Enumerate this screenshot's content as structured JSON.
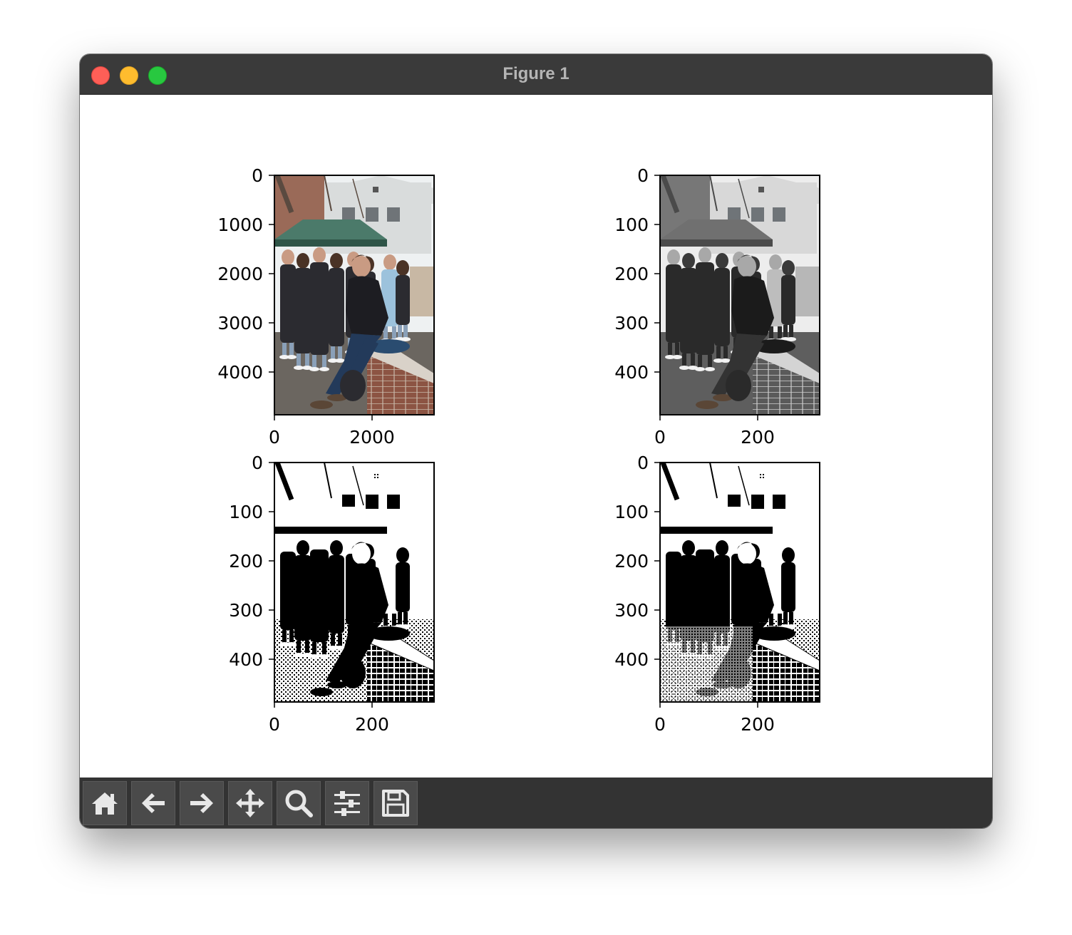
{
  "window": {
    "title": "Figure 1"
  },
  "toolbar": {
    "buttons": [
      {
        "name": "home-button",
        "icon": "home-icon"
      },
      {
        "name": "back-button",
        "icon": "arrow-left-icon"
      },
      {
        "name": "forward-button",
        "icon": "arrow-right-icon"
      },
      {
        "name": "pan-button",
        "icon": "move-icon"
      },
      {
        "name": "zoom-button",
        "icon": "search-icon"
      },
      {
        "name": "configure-subplots-button",
        "icon": "sliders-icon"
      },
      {
        "name": "save-button",
        "icon": "save-icon"
      }
    ]
  },
  "figure": {
    "subplots": [
      {
        "name": "original-color-image",
        "style": "color",
        "yticks": [
          "0",
          "1000",
          "2000",
          "3000",
          "4000"
        ],
        "xticks": [
          "0",
          "2000"
        ]
      },
      {
        "name": "grayscale-image",
        "style": "gray",
        "yticks": [
          "0",
          "100",
          "200",
          "300",
          "400"
        ],
        "xticks": [
          "0",
          "200"
        ]
      },
      {
        "name": "threshold-image",
        "style": "binary",
        "yticks": [
          "0",
          "100",
          "200",
          "300",
          "400"
        ],
        "xticks": [
          "0",
          "200"
        ]
      },
      {
        "name": "dithered-image",
        "style": "binary",
        "yticks": [
          "0",
          "100",
          "200",
          "300",
          "400"
        ],
        "xticks": [
          "0",
          "200"
        ]
      }
    ]
  }
}
